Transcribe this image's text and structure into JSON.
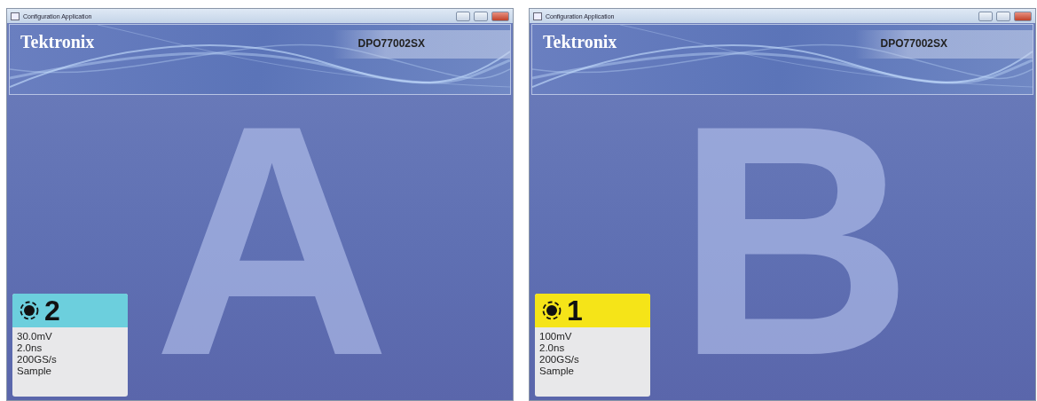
{
  "windows": [
    {
      "title": "Configuration Application",
      "brand": "Tektronix",
      "model": "DPO77002SX",
      "letter": "A",
      "channel": {
        "number": "2",
        "color": "#6ccfdd",
        "readouts": [
          "30.0mV",
          "2.0ns",
          "200GS/s",
          "Sample"
        ]
      }
    },
    {
      "title": "Configuration Application",
      "brand": "Tektronix",
      "model": "DPO77002SX",
      "letter": "B",
      "channel": {
        "number": "1",
        "color": "#f5e418",
        "readouts": [
          "100mV",
          "2.0ns",
          "200GS/s",
          "Sample"
        ]
      }
    }
  ]
}
